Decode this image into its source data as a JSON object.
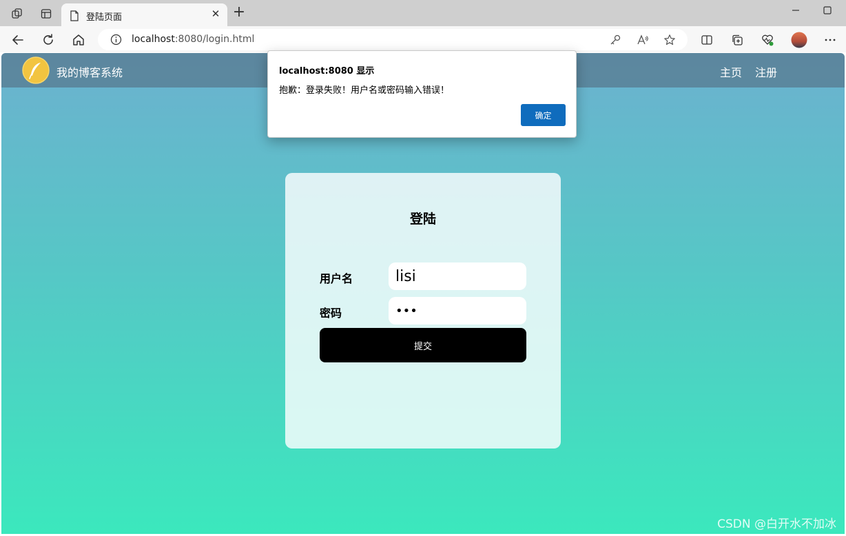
{
  "browser": {
    "tab_title": "登陆页面",
    "url_host": "localhost",
    "url_path": ":8080/login.html"
  },
  "site": {
    "title": "我的博客系统",
    "nav": [
      "主页",
      "注册"
    ]
  },
  "login": {
    "heading": "登陆",
    "username_label": "用户名",
    "username_value": "lisi",
    "password_label": "密码",
    "password_masked": "•••",
    "submit_label": "提交"
  },
  "alert": {
    "title": "localhost:8080 显示",
    "message": "抱歉：登录失败！用户名或密码输入错误！",
    "ok_label": "确定"
  },
  "watermark": "CSDN @白开水不加冰",
  "colors": {
    "accent": "#0f6cbd",
    "gradient_top": "#6cb1cf",
    "gradient_bottom": "#3be8bd",
    "submit_bg": "#000000"
  }
}
